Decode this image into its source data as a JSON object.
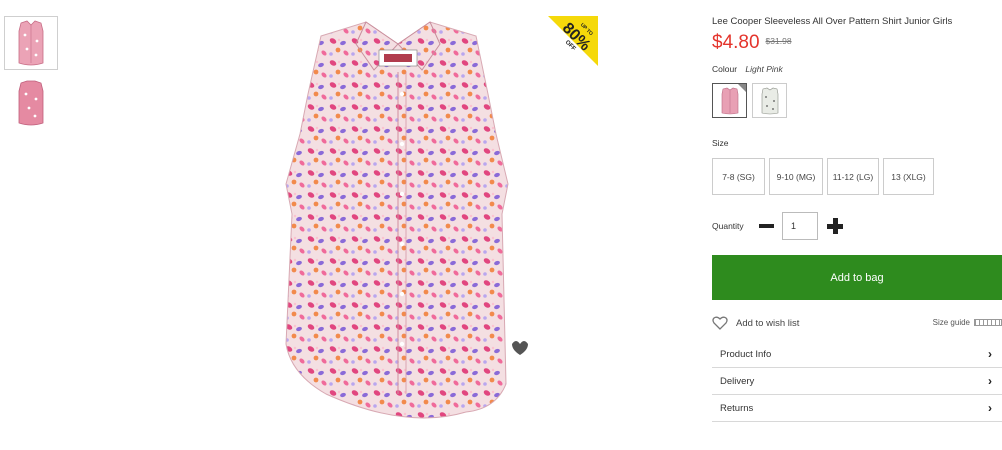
{
  "product": {
    "title": "Lee Cooper Sleeveless All Over Pattern Shirt Junior Girls",
    "price": "$4.80",
    "was_price": "$31.98"
  },
  "promo_badge": {
    "small": "UP TO",
    "big": "80%",
    "suffix": "OFF",
    "color": "#f5d90a"
  },
  "colour": {
    "label": "Colour",
    "value": "Light Pink",
    "swatches": [
      {
        "name": "Light Pink",
        "color": "#e8a0b4",
        "selected": true
      },
      {
        "name": "White pattern",
        "color": "#e9ece6",
        "selected": false
      }
    ]
  },
  "size": {
    "label": "Size",
    "options": [
      "7-8 (SG)",
      "9-10 (MG)",
      "11-12 (LG)",
      "13 (XLG)"
    ]
  },
  "quantity": {
    "label": "Quantity",
    "value": "1"
  },
  "actions": {
    "add_to_bag": "Add to bag",
    "add_to_wish": "Add to wish list",
    "size_guide": "Size guide"
  },
  "accordion": [
    {
      "label": "Product Info"
    },
    {
      "label": "Delivery"
    },
    {
      "label": "Returns"
    }
  ],
  "colors": {
    "price": "#e4342c",
    "add_button": "#2e8b1e",
    "shirt": "#f3d6dc"
  },
  "icons": {
    "wishlist": "heart-outline-icon",
    "chevron": "chevron-right-icon",
    "size_guide": "ruler-icon"
  }
}
